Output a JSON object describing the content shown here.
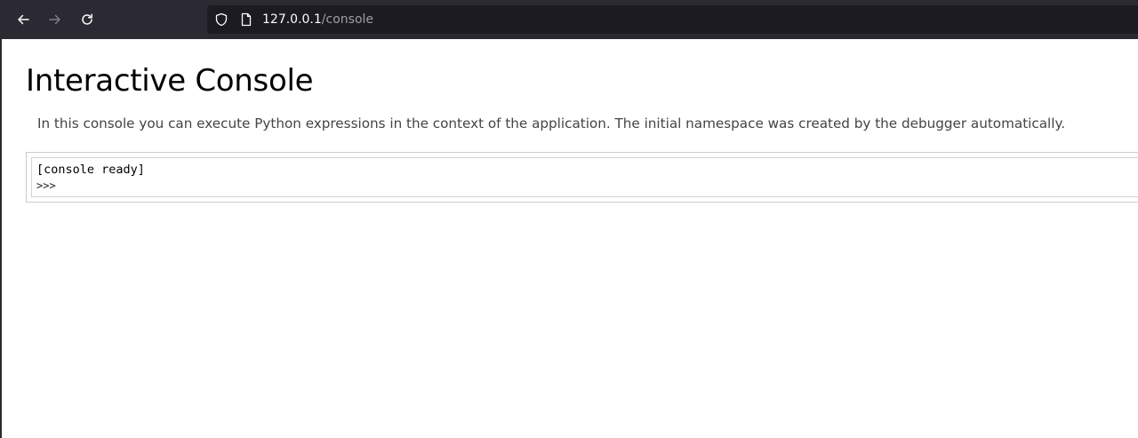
{
  "browser": {
    "url_host": "127.0.0.1",
    "url_path": "/console",
    "icons": {
      "back": "back-arrow-icon",
      "forward": "forward-arrow-icon",
      "reload": "reload-icon",
      "tracking": "shield-icon",
      "page": "page-icon"
    }
  },
  "page": {
    "title": "Interactive Console",
    "intro": "In this console you can execute Python expressions in the context of the application. The initial namespace was created by the debugger automatically."
  },
  "console": {
    "output": "[console ready]",
    "prompt": ">>>",
    "input_value": ""
  },
  "colors": {
    "toolbar_bg": "#2b2a33",
    "urlbar_bg": "#1c1b22",
    "url_host": "#fbfbfe",
    "url_path": "#9e9ea6",
    "page_bg": "#ffffff",
    "intro_text": "#444444"
  }
}
